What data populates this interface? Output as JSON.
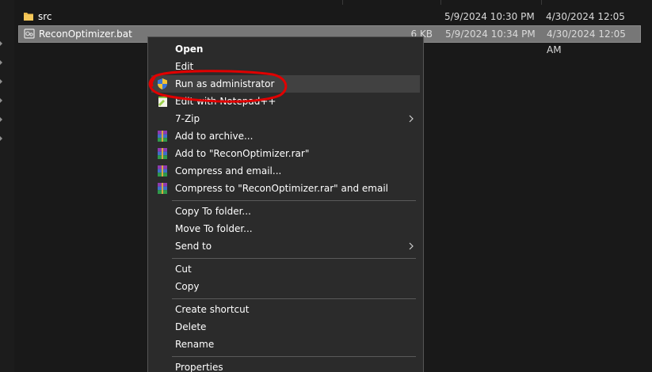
{
  "files": [
    {
      "name": "src",
      "icon": "folder-icon",
      "size": "",
      "modified": "5/9/2024 10:30 PM",
      "created": "4/30/2024 12:05 AM",
      "selected": false
    },
    {
      "name": "ReconOptimizer.bat",
      "icon": "batch-file-icon",
      "size": "6 KB",
      "modified": "5/9/2024 10:34 PM",
      "created": "4/30/2024 12:05 AM",
      "selected": true
    }
  ],
  "context_menu": {
    "items": [
      {
        "label": "Open",
        "bold": true
      },
      {
        "label": "Edit"
      },
      {
        "label": "Run as administrator",
        "icon": "uac-shield-icon",
        "highlighted": true
      },
      {
        "label": "Edit with Notepad++",
        "icon": "notepad-plus-plus-icon"
      },
      {
        "label": "7-Zip",
        "has_submenu": true
      },
      {
        "label": "Add to archive...",
        "icon": "winrar-icon"
      },
      {
        "label": "Add to \"ReconOptimizer.rar\"",
        "icon": "winrar-icon"
      },
      {
        "label": "Compress and email...",
        "icon": "winrar-icon"
      },
      {
        "label": "Compress to \"ReconOptimizer.rar\" and email",
        "icon": "winrar-icon"
      },
      {
        "label": "Copy To folder..."
      },
      {
        "label": "Move To folder..."
      },
      {
        "label": "Send to",
        "has_submenu": true
      },
      {
        "label": "Cut"
      },
      {
        "label": "Copy"
      },
      {
        "label": "Create shortcut"
      },
      {
        "label": "Delete"
      },
      {
        "label": "Rename"
      },
      {
        "label": "Properties"
      }
    ]
  },
  "colors": {
    "background": "#191919",
    "selection": "#777777",
    "menu_background": "#2b2b2b",
    "menu_hover": "#414141",
    "annotation": "#e00000"
  }
}
